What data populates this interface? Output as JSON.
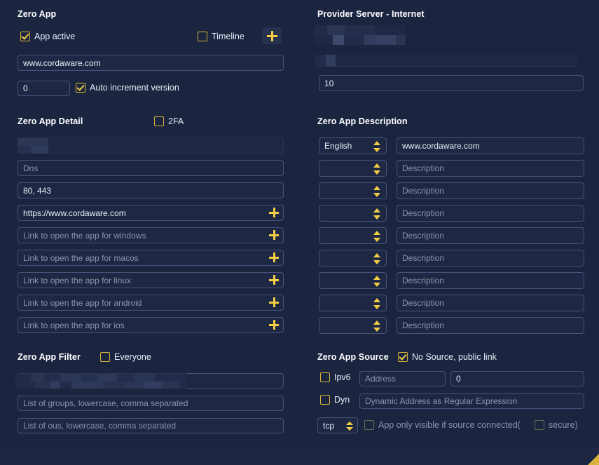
{
  "window": {
    "background": "#1b2540",
    "accent": "#f2cf45",
    "field_border": "#46527a"
  },
  "left": {
    "zero_app": {
      "title": "Zero App",
      "app_active": {
        "label": "App active",
        "checked": true
      },
      "timeline": {
        "label": "Timeline",
        "checked": false
      },
      "add_button_icon": "plus-icon",
      "url_value": "www.cordaware.com",
      "version_value": "0",
      "auto_increment": {
        "label": "Auto increment version",
        "checked": true
      }
    },
    "zero_app_detail": {
      "title": "Zero App Detail",
      "twofa": {
        "label": "2FA",
        "checked": false
      },
      "redacted_field_value": "",
      "dns_placeholder": "Dns",
      "ports_value": "80, 443",
      "url_value": "https://www.cordaware.com",
      "links": [
        {
          "placeholder": "Link to open the app for windows"
        },
        {
          "placeholder": "Link to open the app for macos"
        },
        {
          "placeholder": "Link to open the app for linux"
        },
        {
          "placeholder": "Link to open the app for android"
        },
        {
          "placeholder": "Link to open the app for ios"
        }
      ]
    },
    "zero_app_filter": {
      "title": "Zero App Filter",
      "everyone": {
        "label": "Everyone",
        "checked": false
      },
      "redacted_field_value": "",
      "second_field_value": "",
      "groups_placeholder": "List of groups, lowercase, comma separated",
      "ous_placeholder": "List of ous, lowercase, comma separated"
    }
  },
  "right": {
    "provider_server": {
      "title": "Provider Server - Internet",
      "redacted_row_1": "",
      "redacted_row_2": "",
      "count_value": "10"
    },
    "zero_app_description": {
      "title": "Zero App Description",
      "rows": [
        {
          "language": "English",
          "description_value": "www.cordaware.com",
          "description_placeholder": "Description"
        },
        {
          "language": "",
          "description_value": "",
          "description_placeholder": "Description"
        },
        {
          "language": "",
          "description_value": "",
          "description_placeholder": "Description"
        },
        {
          "language": "",
          "description_value": "",
          "description_placeholder": "Description"
        },
        {
          "language": "",
          "description_value": "",
          "description_placeholder": "Description"
        },
        {
          "language": "",
          "description_value": "",
          "description_placeholder": "Description"
        },
        {
          "language": "",
          "description_value": "",
          "description_placeholder": "Description"
        },
        {
          "language": "",
          "description_value": "",
          "description_placeholder": "Description"
        },
        {
          "language": "",
          "description_value": "",
          "description_placeholder": "Description"
        }
      ]
    },
    "zero_app_source": {
      "title": "Zero App Source",
      "no_source": {
        "label": "No Source, public link",
        "checked": true
      },
      "ipv6": {
        "label": "Ipv6",
        "checked": false
      },
      "address_placeholder": "Address",
      "port_value": "0",
      "dyn": {
        "label": "Dyn",
        "checked": false
      },
      "dynamic_placeholder": "Dynamic Address as Regular Expression",
      "protocol_value": "tcp",
      "source_connected": {
        "label": "App only visible if source connected(",
        "checked": false
      },
      "secure": {
        "label": "secure)",
        "checked": false
      }
    }
  }
}
